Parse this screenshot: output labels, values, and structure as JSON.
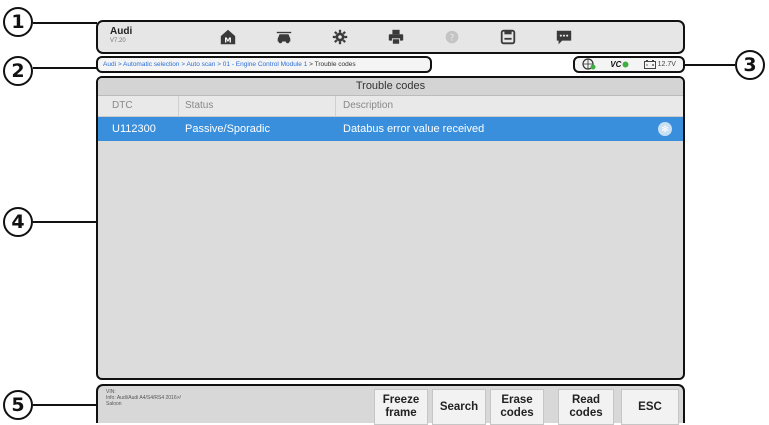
{
  "callouts": [
    "1",
    "2",
    "3",
    "4",
    "5"
  ],
  "toolbar": {
    "brand": "Audi",
    "version": "V7.20",
    "buttons": [
      "home-icon",
      "vehicle-menu-icon",
      "settings-icon",
      "print-icon",
      "help-icon",
      "save-icon",
      "data-logging-icon"
    ]
  },
  "breadcrumb": {
    "link_text": "Audi > Automatic selection > Auto scan > 01 - Engine Control Module 1",
    "separator": " > ",
    "current": "Trouble codes"
  },
  "status": {
    "vci_label": "VC",
    "battery_voltage": "12.7V",
    "colors": {
      "connected": "#3cb043"
    }
  },
  "panel": {
    "title": "Trouble codes",
    "columns": [
      "DTC",
      "Status",
      "Description"
    ],
    "rows": [
      {
        "dtc": "U112300",
        "status": "Passive/Sporadic",
        "description": "Databus error value received"
      }
    ]
  },
  "bottom": {
    "info_lines": [
      "VIN:",
      "Info: Audi/Audi A4/S4/RS4 2016>/",
      "Saloon"
    ],
    "buttons": [
      "Freeze\nframe",
      "Search",
      "Erase\ncodes",
      "Read\ncodes",
      "ESC"
    ]
  },
  "colors": {
    "accent": "#3a8fdd",
    "frame": "#111111",
    "panel": "#dcdcdc"
  }
}
